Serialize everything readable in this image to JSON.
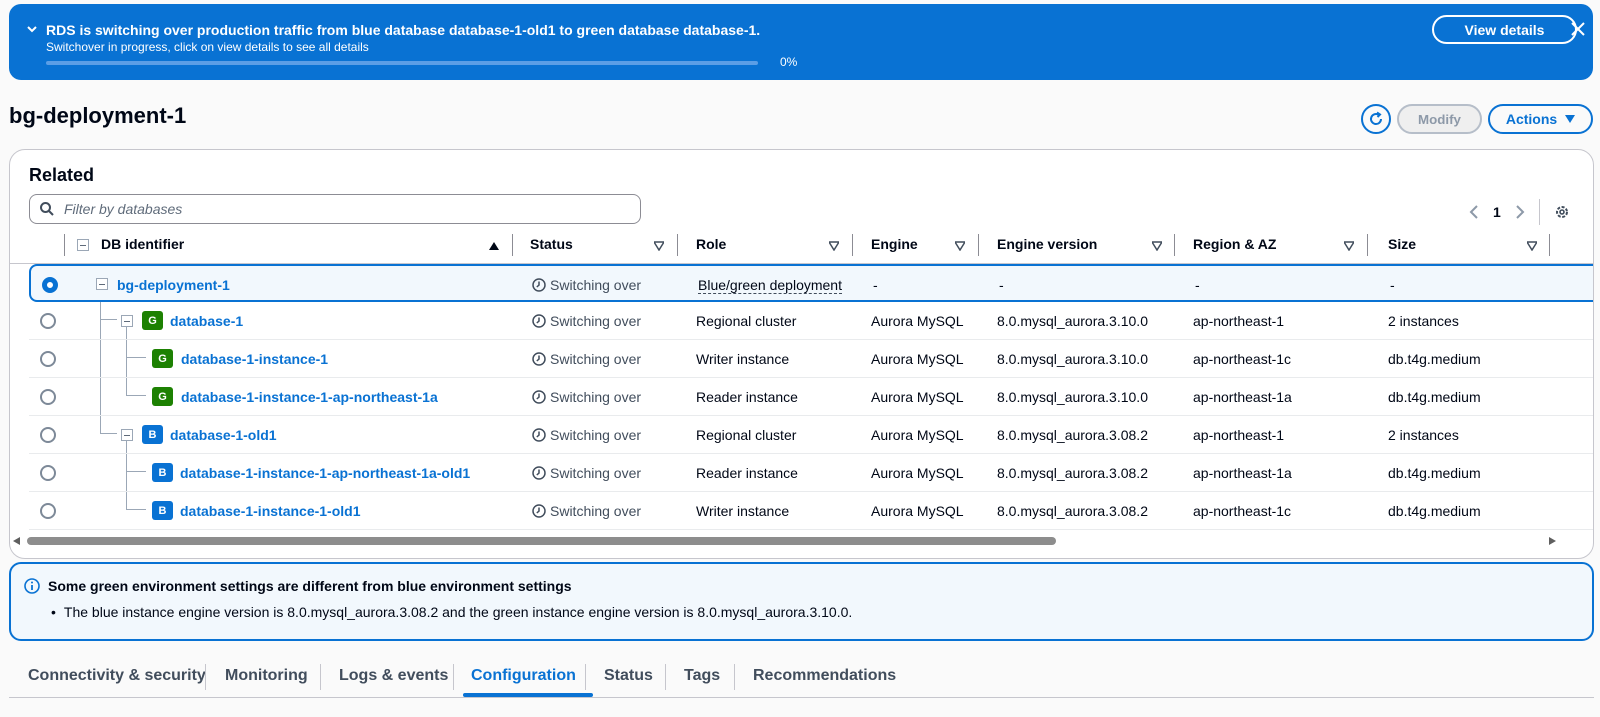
{
  "flash": {
    "title": "RDS is switching over production traffic from blue database database-1-old1 to green database database-1.",
    "subtitle": "Switchover in progress, click on view details to see all details",
    "progress": 0,
    "progress_label": "0%",
    "view_details": "View details"
  },
  "header": {
    "title": "bg-deployment-1",
    "modify": "Modify",
    "actions": "Actions"
  },
  "related": {
    "title": "Related",
    "filter_placeholder": "Filter by databases",
    "page": "1"
  },
  "columns": {
    "id": "DB identifier",
    "status": "Status",
    "role": "Role",
    "engine": "Engine",
    "version": "Engine version",
    "region": "Region & AZ",
    "size": "Size"
  },
  "rows": [
    {
      "id": "bg-deployment-1",
      "badge": "",
      "status": "Switching over",
      "role": "Blue/green deployment",
      "engine": "-",
      "version": "-",
      "region": "-",
      "size": "-"
    },
    {
      "id": "database-1",
      "badge": "G",
      "status": "Switching over",
      "role": "Regional cluster",
      "engine": "Aurora MySQL",
      "version": "8.0.mysql_aurora.3.10.0",
      "region": "ap-northeast-1",
      "size": "2 instances"
    },
    {
      "id": "database-1-instance-1",
      "badge": "G",
      "status": "Switching over",
      "role": "Writer instance",
      "engine": "Aurora MySQL",
      "version": "8.0.mysql_aurora.3.10.0",
      "region": "ap-northeast-1c",
      "size": "db.t4g.medium"
    },
    {
      "id": "database-1-instance-1-ap-northeast-1a",
      "badge": "G",
      "status": "Switching over",
      "role": "Reader instance",
      "engine": "Aurora MySQL",
      "version": "8.0.mysql_aurora.3.10.0",
      "region": "ap-northeast-1a",
      "size": "db.t4g.medium"
    },
    {
      "id": "database-1-old1",
      "badge": "B",
      "status": "Switching over",
      "role": "Regional cluster",
      "engine": "Aurora MySQL",
      "version": "8.0.mysql_aurora.3.08.2",
      "region": "ap-northeast-1",
      "size": "2 instances"
    },
    {
      "id": "database-1-instance-1-ap-northeast-1a-old1",
      "badge": "B",
      "status": "Switching over",
      "role": "Reader instance",
      "engine": "Aurora MySQL",
      "version": "8.0.mysql_aurora.3.08.2",
      "region": "ap-northeast-1a",
      "size": "db.t4g.medium"
    },
    {
      "id": "database-1-instance-1-old1",
      "badge": "B",
      "status": "Switching over",
      "role": "Writer instance",
      "engine": "Aurora MySQL",
      "version": "8.0.mysql_aurora.3.08.2",
      "region": "ap-northeast-1c",
      "size": "db.t4g.medium"
    }
  ],
  "alert": {
    "title": "Some green environment settings are different from blue environment settings",
    "body": "The blue instance engine version is 8.0.mysql_aurora.3.08.2 and the green instance engine version is 8.0.mysql_aurora.3.10.0."
  },
  "tabs": [
    "Connectivity & security",
    "Monitoring",
    "Logs & events",
    "Configuration",
    "Status",
    "Tags",
    "Recommendations"
  ],
  "active_tab": "Configuration",
  "colors": {
    "accent": "#0972d3",
    "green_badge": "#1d8102",
    "blue_badge": "#0972d3"
  }
}
